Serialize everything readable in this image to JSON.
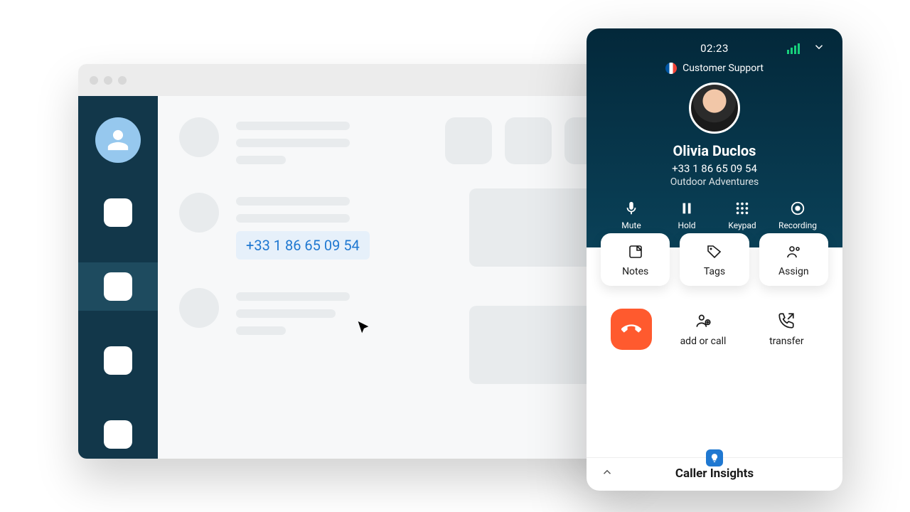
{
  "crm": {
    "clickable_phone": "+33 1 86 65 09 54"
  },
  "phone": {
    "timer": "02:23",
    "queue": "Customer Support",
    "caller": {
      "name": "Olivia Duclos",
      "phone": "+33 1 86 65 09 54",
      "company": "Outdoor Adventures"
    },
    "controls": {
      "mute": "Mute",
      "hold": "Hold",
      "keypad": "Keypad",
      "recording": "Recording"
    },
    "cards": {
      "notes": "Notes",
      "tags": "Tags",
      "assign": "Assign"
    },
    "actions": {
      "add_or_call": "add or call",
      "transfer": "transfer"
    },
    "footer": "Caller Insights"
  }
}
